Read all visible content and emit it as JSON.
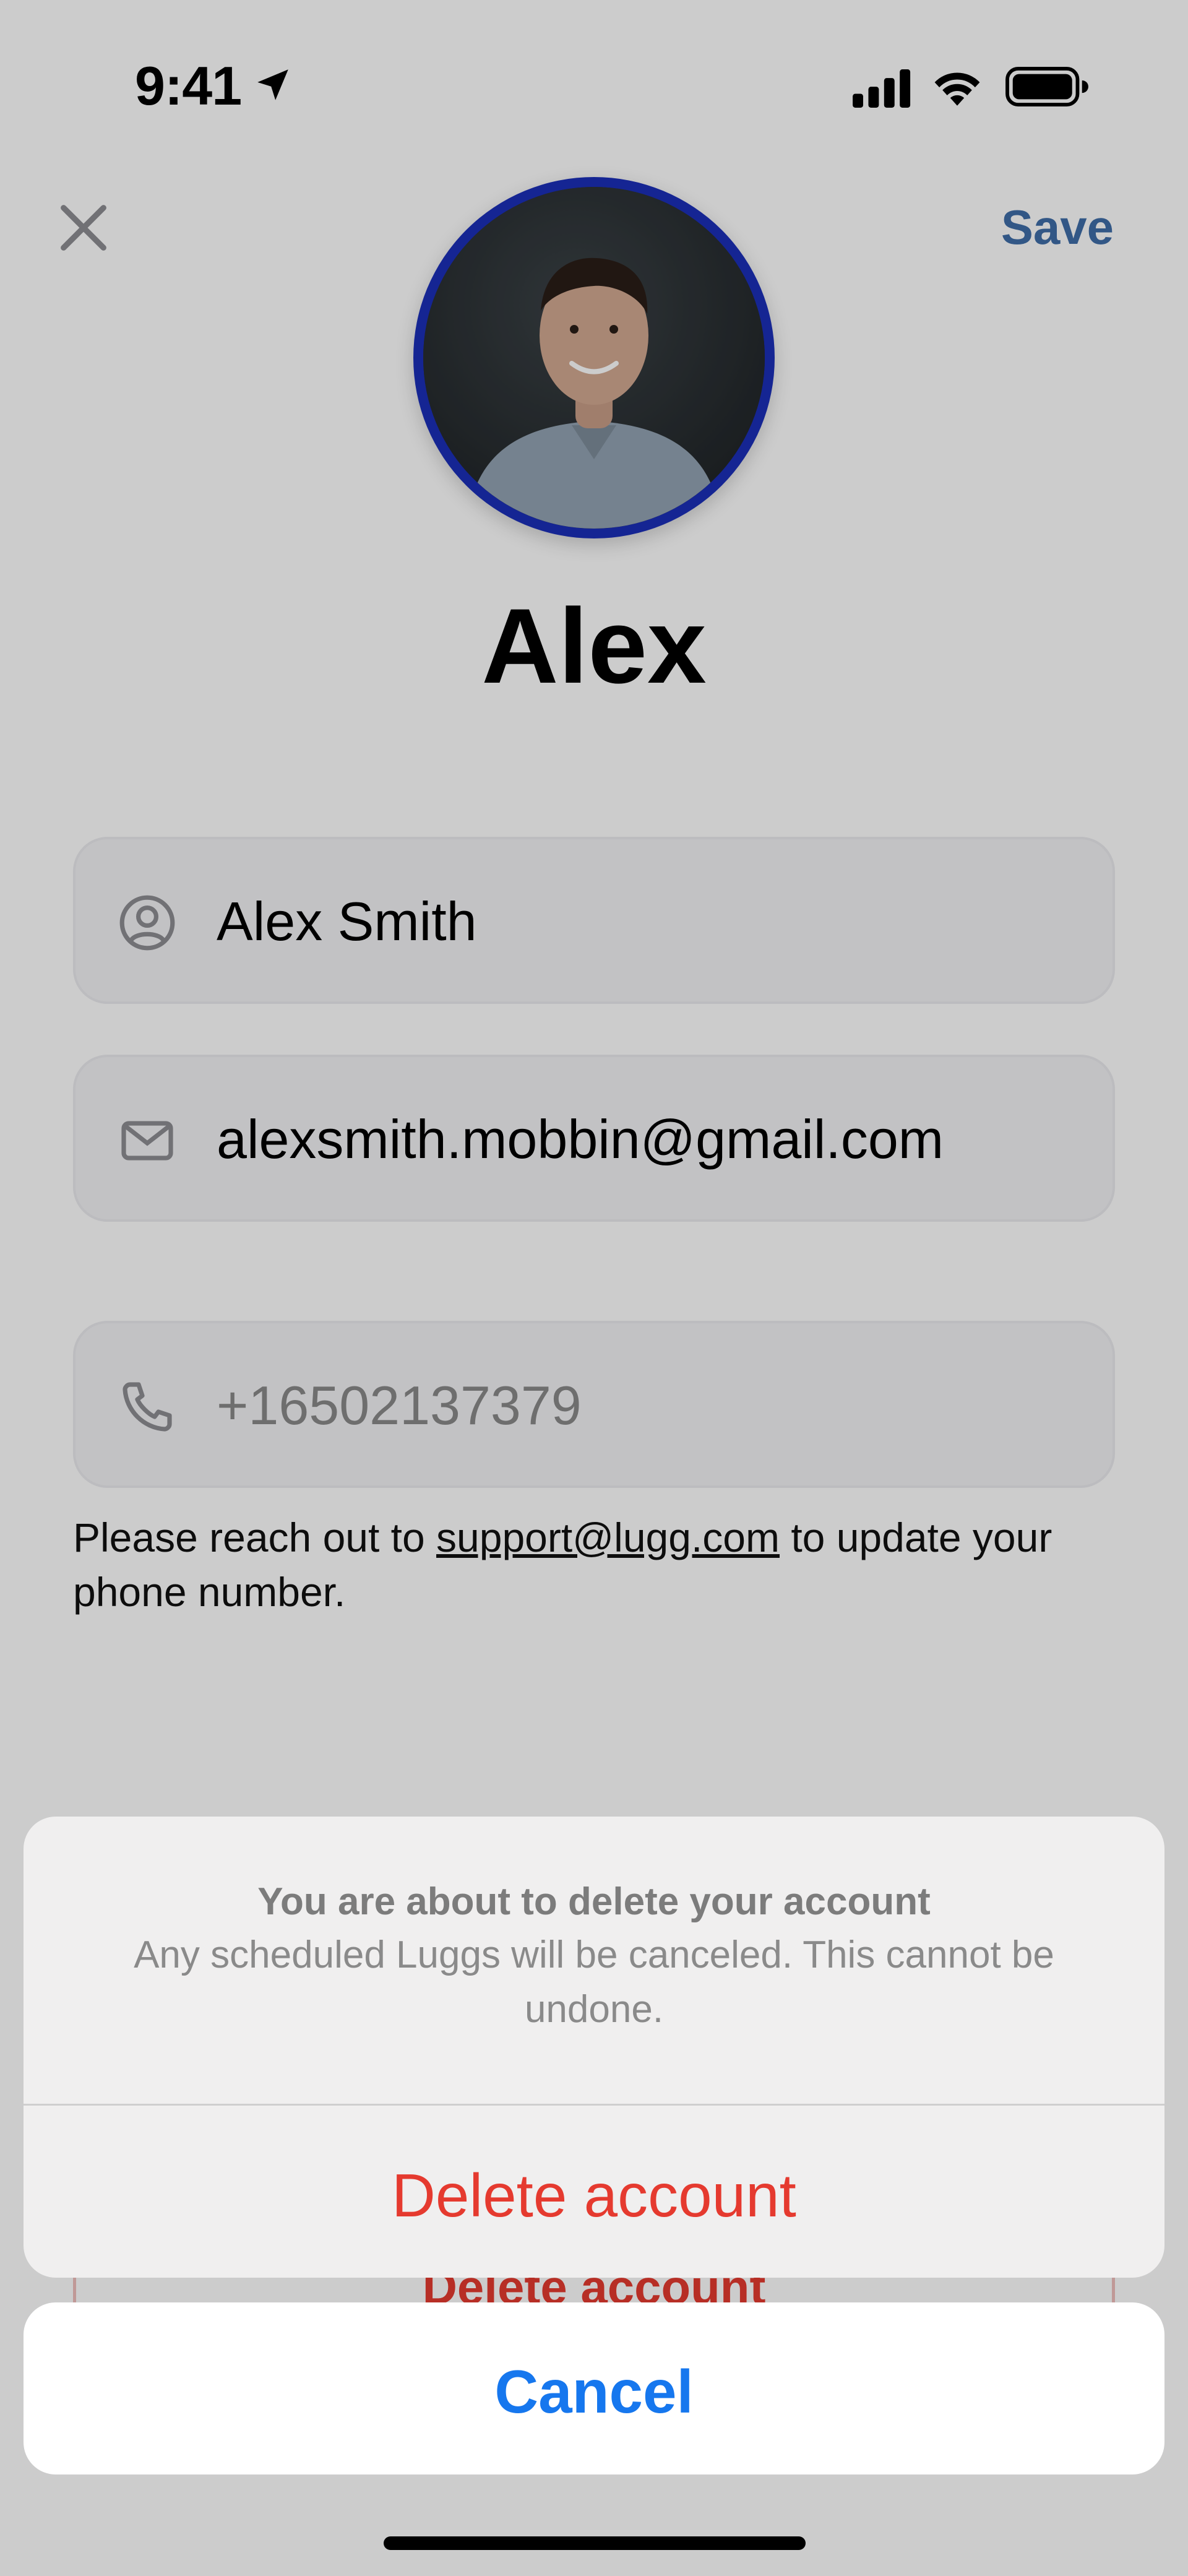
{
  "status_bar": {
    "time": "9:41"
  },
  "header": {
    "save_label": "Save"
  },
  "profile": {
    "display_name": "Alex"
  },
  "fields": {
    "name": {
      "value": "Alex Smith"
    },
    "email": {
      "value": "alexsmith.mobbin@gmail.com"
    },
    "phone": {
      "value": "+16502137379"
    }
  },
  "helper": {
    "prefix": "Please reach out to ",
    "link": "support@lugg.com",
    "suffix": " to update your phone number."
  },
  "behind_button": {
    "label": "Delete account"
  },
  "action_sheet": {
    "title": "You are about to delete your account",
    "message": "Any scheduled Luggs will be canceled. This cannot be undone.",
    "destructive_label": "Delete account",
    "cancel_label": "Cancel"
  },
  "colors": {
    "accent": "#1677ee",
    "destructive": "#e53a2f",
    "avatar_ring": "#1b2fb8",
    "save": "#3f6da8"
  },
  "icons": [
    "location-arrow-icon",
    "signal-icon",
    "wifi-icon",
    "battery-icon",
    "close-icon",
    "person-circle-icon",
    "envelope-icon",
    "phone-icon"
  ]
}
